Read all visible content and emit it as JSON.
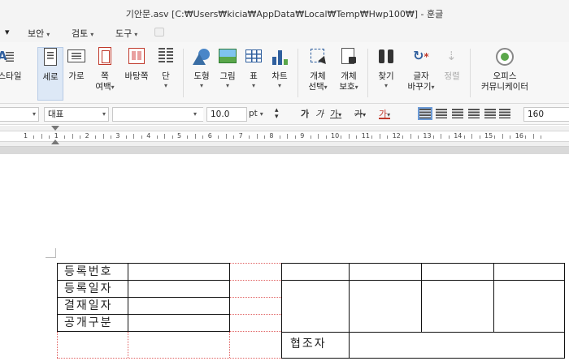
{
  "window": {
    "title": "기안문.asv [C:₩Users₩kicia₩AppData₩Local₩Temp₩Hwp100₩] - 훈글"
  },
  "menu": {
    "items": [
      {
        "label": "보안"
      },
      {
        "label": "검토"
      },
      {
        "label": "도구"
      }
    ],
    "leading_arrow": "▾"
  },
  "ribbon": {
    "style_label": "스타일",
    "portrait_label": "세로",
    "landscape_label": "가로",
    "page_margin_label_1": "쪽",
    "page_margin_label_2": "여백",
    "background_label": "바탕쪽",
    "columns_label": "단",
    "shape_label": "도형",
    "picture_label": "그림",
    "table_label": "표",
    "chart_label": "차트",
    "object_select_1": "개체",
    "object_select_2": "선택",
    "object_protect_1": "개체",
    "object_protect_2": "보호",
    "find_label": "찾기",
    "replace_label_1": "글자",
    "replace_label_2": "바꾸기",
    "sort_label": "정렬",
    "office_label_1": "오피스",
    "office_label_2": "커뮤니케이터",
    "dropdown_arrow": "▾",
    "colors": {
      "active_bg": "#dde8f6",
      "disabled": "#aaaaaa"
    }
  },
  "format_bar": {
    "style_value": "대표",
    "font_size_value": "10.0",
    "unit_value": "pt",
    "bold_label": "가",
    "italic_label": "가",
    "underline_label": "가",
    "strike_label": "가",
    "color_label": "가",
    "line_spacing_value": "160"
  },
  "ruler": {
    "numbers": [
      "1",
      "1",
      "2",
      "3",
      "4",
      "5",
      "6",
      "7",
      "8",
      "9",
      "10",
      "11",
      "12",
      "13",
      "14",
      "15",
      "16"
    ]
  },
  "document": {
    "left_table": {
      "rows": [
        {
          "label": "등록번호"
        },
        {
          "label": "등록일자"
        },
        {
          "label": "결재일자"
        },
        {
          "label": "공개구분"
        }
      ]
    },
    "right_table": {
      "footer_label": "협조자"
    }
  }
}
